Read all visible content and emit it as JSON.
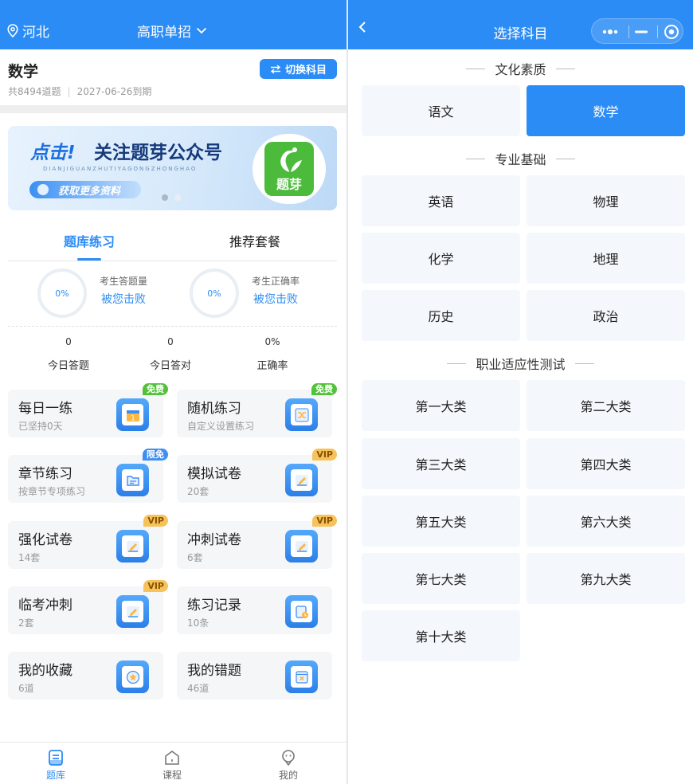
{
  "left": {
    "header": {
      "location": "河北",
      "exam_type": "高职单招"
    },
    "subject": {
      "name": "数学",
      "count": "共8494道题",
      "expiry": "2027-06-26到期",
      "switch_label": "切换科目"
    },
    "banner": {
      "headline_1": "点击!",
      "headline_2": "关注题芽公众号",
      "pinyin": "DIANJIGUANZHUTIYAGONGZHONGHAO",
      "cta": "获取更多资料",
      "logo_text": "题芽"
    },
    "tabs": {
      "practice": "题库练习",
      "packages": "推荐套餐"
    },
    "rings": [
      {
        "percent": "0%",
        "label": "考生答题量",
        "link": "被您击败"
      },
      {
        "percent": "0%",
        "label": "考生正确率",
        "link": "被您击败"
      }
    ],
    "stats": [
      {
        "value": "0",
        "label": "今日答题"
      },
      {
        "value": "0",
        "label": "今日答对"
      },
      {
        "value": "0%",
        "label": "正确率"
      }
    ],
    "cards": [
      {
        "title": "每日一练",
        "sub": "已坚持0天",
        "badge": "免费",
        "badge_type": "free",
        "icon": "calendar-icon"
      },
      {
        "title": "随机练习",
        "sub": "自定义设置练习",
        "badge": "免费",
        "badge_type": "free",
        "icon": "shuffle-icon"
      },
      {
        "title": "章节练习",
        "sub": "按章节专项练习",
        "badge": "限免",
        "badge_type": "limited",
        "icon": "folder-icon"
      },
      {
        "title": "模拟试卷",
        "sub": "20套",
        "badge": "VIP",
        "badge_type": "vip",
        "icon": "pen-paper-icon"
      },
      {
        "title": "强化试卷",
        "sub": "14套",
        "badge": "VIP",
        "badge_type": "vip",
        "icon": "pen-paper-icon"
      },
      {
        "title": "冲刺试卷",
        "sub": "6套",
        "badge": "VIP",
        "badge_type": "vip",
        "icon": "pen-paper-icon"
      },
      {
        "title": "临考冲刺",
        "sub": "2套",
        "badge": "VIP",
        "badge_type": "vip",
        "icon": "pen-paper-icon"
      },
      {
        "title": "练习记录",
        "sub": "10条",
        "badge": "",
        "badge_type": "",
        "icon": "record-clock-icon"
      },
      {
        "title": "我的收藏",
        "sub": "6道",
        "badge": "",
        "badge_type": "",
        "icon": "star-icon"
      },
      {
        "title": "我的错题",
        "sub": "46道",
        "badge": "",
        "badge_type": "",
        "icon": "wrong-book-icon"
      }
    ],
    "nav": [
      {
        "label": "题库",
        "icon": "question-bank-icon",
        "active": true
      },
      {
        "label": "课程",
        "icon": "course-home-icon",
        "active": false
      },
      {
        "label": "我的",
        "icon": "profile-icon",
        "active": false
      }
    ]
  },
  "right": {
    "title": "选择科目",
    "sections": [
      {
        "title": "文化素质",
        "options": [
          "语文",
          "数学"
        ],
        "selected": "数学"
      },
      {
        "title": "专业基础",
        "options": [
          "英语",
          "物理",
          "化学",
          "地理",
          "历史",
          "政治"
        ]
      },
      {
        "title": "职业适应性测试",
        "options": [
          "第一大类",
          "第二大类",
          "第三大类",
          "第四大类",
          "第五大类",
          "第六大类",
          "第七大类",
          "第九大类",
          "第十大类"
        ]
      }
    ]
  },
  "colors": {
    "accent": "#2b8cf6",
    "free": "#53c23a",
    "vip": "#f6c25b",
    "card_bg": "#f5f6f8",
    "option_bg": "#f4f7fc"
  }
}
